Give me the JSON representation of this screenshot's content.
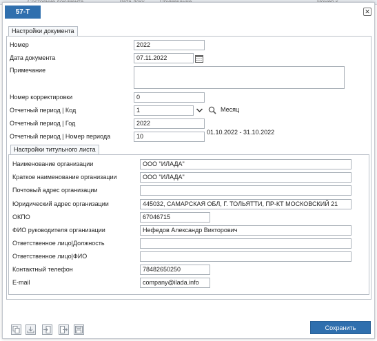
{
  "background": {
    "columns": [
      "Состояние документа",
      "Дата доку...",
      "Примечание",
      "Номер к..."
    ]
  },
  "dialog": {
    "title": "57-Т",
    "close_glyph": "✕",
    "accent_color": "#2f6fae"
  },
  "doc_settings": {
    "tab_label": "Настройки документа",
    "number_label": "Номер",
    "number_value": "2022",
    "date_label": "Дата документа",
    "date_value": "07.11.2022",
    "date_icon": "calendar-icon",
    "note_label": "Примечание",
    "note_value": "",
    "correction_label": "Номер корректировки",
    "correction_value": "0",
    "period_code_label": "Отчетный период | Код",
    "period_code_value": "1",
    "period_code_desc": "Месяц",
    "period_year_label": "Отчетный период | Год",
    "period_year_value": "2022",
    "period_number_label": "Отчетный период | Номер периода",
    "period_number_value": "10",
    "period_range": "01.10.2022 - 31.10.2022"
  },
  "title_settings": {
    "tab_label": "Настройки титульного листа",
    "fields": [
      {
        "label": "Наименование организации",
        "value": "ООО \"ИЛАДА\""
      },
      {
        "label": "Краткое наименование организации",
        "value": "ООО \"ИЛАДА\""
      },
      {
        "label": "Почтовый адрес организации",
        "value": ""
      },
      {
        "label": "Юридический адрес организации",
        "value": "445032, САМАРСКАЯ ОБЛ, Г. ТОЛЬЯТТИ, ПР-КТ МОСКОВСКИЙ 21"
      },
      {
        "label": "ОКПО",
        "value": "67046715"
      },
      {
        "label": "ФИО руководителя организации",
        "value": "Нефедов Александр Викторович"
      },
      {
        "label": "Ответственное лицо|Должность",
        "value": ""
      },
      {
        "label": "Ответственное лицо|ФИО",
        "value": ""
      },
      {
        "label": "Контактный телефон",
        "value": "78482650250"
      },
      {
        "label": "E-mail",
        "value": "company@ilada.info"
      }
    ]
  },
  "footer": {
    "save_label": "Сохранить",
    "icons": [
      "copy-icon",
      "import-icon",
      "import-file-icon",
      "export-icon",
      "save-disk-icon"
    ]
  }
}
